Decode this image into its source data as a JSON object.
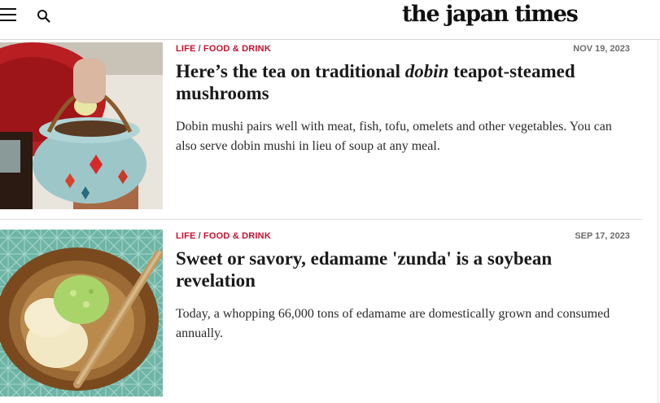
{
  "header": {
    "menu_icon": "hamburger-menu-icon",
    "search_icon": "search-icon",
    "logo_text": "the japan times"
  },
  "articles": [
    {
      "section": "LIFE",
      "subsection": "FOOD & DRINK",
      "date": "NOV 19, 2023",
      "title_pre": "Here’s the tea on traditional ",
      "title_italic": "dobin",
      "title_post": " teapot-steamed mushrooms",
      "summary": "Dobin mushi pairs well with meat, fish, tofu, omelets and other vegetables. You can also serve dobin mushi in lieu of soup at any meal.",
      "image": "dobin-teapot-photo"
    },
    {
      "section": "LIFE",
      "subsection": "FOOD & DRINK",
      "date": "SEP 17, 2023",
      "title_pre": "Sweet or savory, edamame 'zunda' is a soybean revelation",
      "title_italic": "",
      "title_post": "",
      "summary": "Today, a whopping 66,000 tons of edamame are domestically grown and consumed annually.",
      "image": "zunda-ice-cream-photo"
    }
  ],
  "colors": {
    "kicker": "#c8102e",
    "date": "#6b6b6b",
    "text": "#1a1a1a"
  }
}
